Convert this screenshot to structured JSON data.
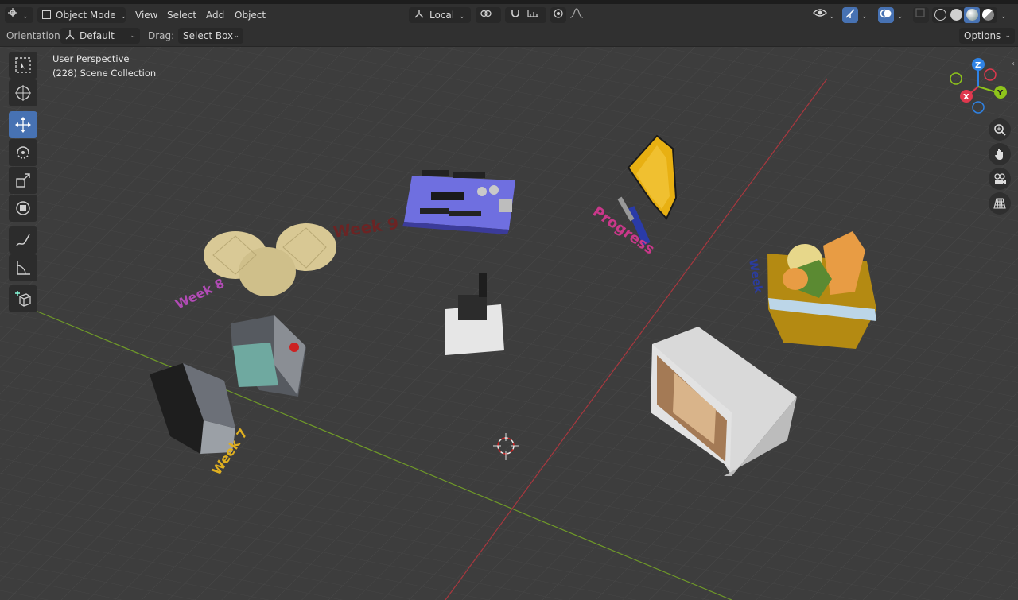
{
  "header": {
    "editor_type_icon": "3d-viewport-icon",
    "mode": "Object Mode",
    "menus": [
      "View",
      "Select",
      "Add",
      "Object"
    ],
    "transform_orientation": "Local",
    "icons": [
      "link-icon",
      "snap-icon",
      "snap-options-icon",
      "proportional-edit-icon",
      "falloff-icon",
      "visibility-icon",
      "gizmo-icon",
      "overlay-icon",
      "xray-icon",
      "wireframe-shading-icon",
      "solid-shading-icon",
      "material-shading-icon",
      "rendered-shading-icon"
    ]
  },
  "tool_header": {
    "orientation_label": "Orientation:",
    "orientation_value": "Default",
    "drag_label": "Drag:",
    "drag_value": "Select Box",
    "options_label": "Options"
  },
  "viewport": {
    "perspective_label": "User Perspective",
    "collection_label": "(228) Scene Collection",
    "scene_texts": [
      "Week 9",
      "Week 8",
      "Week 7",
      "Progress"
    ]
  },
  "toolbar": {
    "tools": [
      "select-box-icon",
      "cursor-icon",
      "move-icon",
      "rotate-icon",
      "scale-icon",
      "transform-icon",
      "annotate-icon",
      "measure-icon",
      "add-cube-icon"
    ],
    "active_tool": "move-icon"
  },
  "gizmo": {
    "axes": [
      "X",
      "Y",
      "Z"
    ],
    "colors": {
      "x": "#e0384e",
      "y": "#8ec41b",
      "z": "#2f83e6"
    }
  },
  "navigation": [
    "zoom-icon",
    "pan-hand-icon",
    "camera-icon",
    "ortho-grid-icon"
  ],
  "colors": {
    "background": "#3d3d3d",
    "header": "#303030",
    "accent": "#4772b3",
    "x_axis": "#a8373e",
    "y_axis": "#6f9a28"
  }
}
